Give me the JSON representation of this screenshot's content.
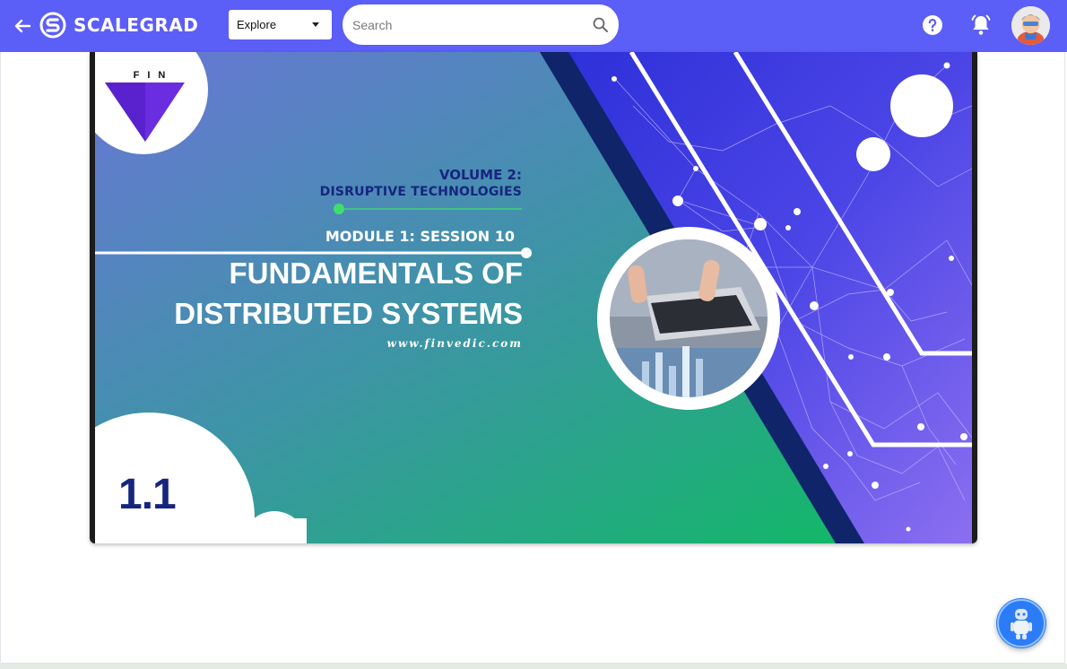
{
  "header": {
    "brand_name": "SCALEGRAD",
    "explore_label": "Explore",
    "search_placeholder": "Search",
    "brand_color": "#5b5ef7"
  },
  "icons": [
    "back-arrow-icon",
    "scalegrad-logo-icon",
    "caret-down-icon",
    "search-icon",
    "help-icon",
    "bell-icon",
    "avatar",
    "assistant-robot-icon"
  ],
  "slide": {
    "logo_text": "FIN",
    "volume_title": "VOLUME 2:",
    "volume_subtitle": "DISRUPTIVE TECHNOLOGIES",
    "module_session": "MODULE 1: SESSION 10",
    "title_line1": "FUNDAMENTALS OF",
    "title_line2": "DISTRIBUTED SYSTEMS",
    "website": "www.finvedic.com",
    "slide_number": "1.1",
    "colors": {
      "gradient_start": "#6878d8",
      "gradient_end": "#0fbd62",
      "network_bg": "#2a2fd6",
      "accent_dot": "#3fe06a",
      "title_dark": "#16257e",
      "logo_purple": "#6a2de0"
    }
  }
}
